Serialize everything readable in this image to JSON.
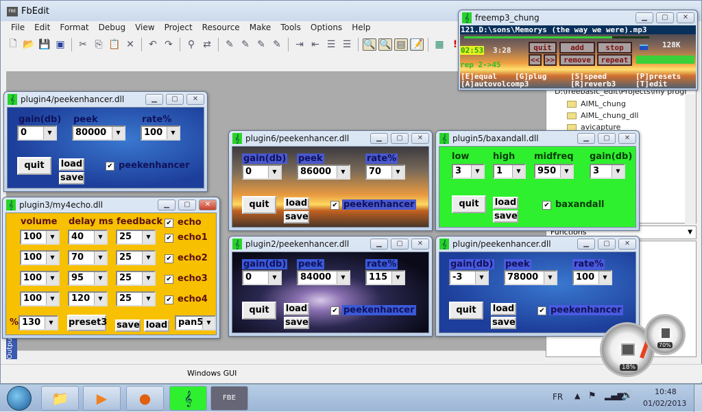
{
  "app": {
    "title": "FbEdit",
    "menu": [
      "File",
      "Edit",
      "Format",
      "Debug",
      "View",
      "Project",
      "Resource",
      "Make",
      "Tools",
      "Options",
      "Help"
    ],
    "status_text": "Windows GUI",
    "output_tab": "Output"
  },
  "project": {
    "root": "D:\\freebasic_edit\\Projects\\my progr",
    "folders": [
      "AIML_chung",
      "AIML_chung_dll",
      "avicapture"
    ],
    "functions_label": "Functions"
  },
  "plugin4": {
    "title": "plugin4/peekenhancer.dll",
    "labels": [
      "gain(db)",
      "peek",
      "rate%"
    ],
    "values": [
      "0",
      "80000",
      "100"
    ],
    "quit": "quit",
    "load": "load",
    "save": "save",
    "checkbox": "peekenhancer",
    "checked": true
  },
  "plugin6": {
    "title": "plugin6/peekenhancer.dll",
    "labels": [
      "gain(db)",
      "peek",
      "rate%"
    ],
    "values": [
      "0",
      "86000",
      "70"
    ],
    "quit": "quit",
    "load": "load",
    "save": "save",
    "checkbox": "peekenhancer",
    "checked": true
  },
  "plugin2": {
    "title": "plugin2/peekenhancer.dll",
    "labels": [
      "gain(db)",
      "peek",
      "rate%"
    ],
    "values": [
      "0",
      "84000",
      "115"
    ],
    "quit": "quit",
    "load": "load",
    "save": "save",
    "checkbox": "peekenhancer",
    "checked": true
  },
  "plugin": {
    "title": "plugin/peekenhancer.dll",
    "labels": [
      "gain(db)",
      "peek",
      "rate%"
    ],
    "values": [
      "-3",
      "78000",
      "100"
    ],
    "quit": "quit",
    "load": "load",
    "save": "save",
    "checkbox": "peekenhancer",
    "checked": true
  },
  "plugin5": {
    "title": "plugin5/baxandall.dll",
    "labels": [
      "low",
      "high",
      "midfreq",
      "gain(db)"
    ],
    "values": [
      "3",
      "1",
      "950",
      "3"
    ],
    "quit": "quit",
    "load": "load",
    "save": "save",
    "checkbox": "baxandall",
    "checked": true
  },
  "plugin3": {
    "title": "plugin3/my4echo.dll",
    "headers": [
      "volume",
      "delay ms",
      "feedback"
    ],
    "echo_label": "echo",
    "rows": [
      {
        "volume": "100",
        "delay": "40",
        "feedback": "25",
        "label": "echo1"
      },
      {
        "volume": "100",
        "delay": "70",
        "feedback": "25",
        "label": "echo2"
      },
      {
        "volume": "100",
        "delay": "95",
        "feedback": "25",
        "label": "echo3"
      },
      {
        "volume": "100",
        "delay": "120",
        "feedback": "25",
        "label": "echo4"
      }
    ],
    "percent_label": "%",
    "percent": "130",
    "preset": "preset3",
    "save": "save",
    "load": "load",
    "pan": "pan5"
  },
  "player": {
    "title": "freemp3_chung",
    "track": "121.D:\\sons\\Memorys (the way we were).mp3",
    "elapsed": "02:53",
    "total": "3:28",
    "bitrate": "128K",
    "repeat_info": "rep 2->45",
    "progress": 0.8,
    "volume": 1.0,
    "buttons": {
      "quit": "quit",
      "add": "add",
      "stop": "stop",
      "prev": "<<",
      "next": ">>",
      "remove": "remove",
      "repeat": "repeat"
    },
    "shortcuts": [
      "[E]equal",
      "[G]plug",
      "[S]speed",
      "[P]presets",
      "[A]autovolcomp3",
      "[R]reverb3",
      "[T]edit"
    ]
  },
  "gadgets": {
    "cpu": "18%",
    "memory": "70%"
  },
  "taskbar": {
    "language": "FR",
    "time": "10:48",
    "date": "01/02/2013",
    "fbe_label": "FBE"
  }
}
